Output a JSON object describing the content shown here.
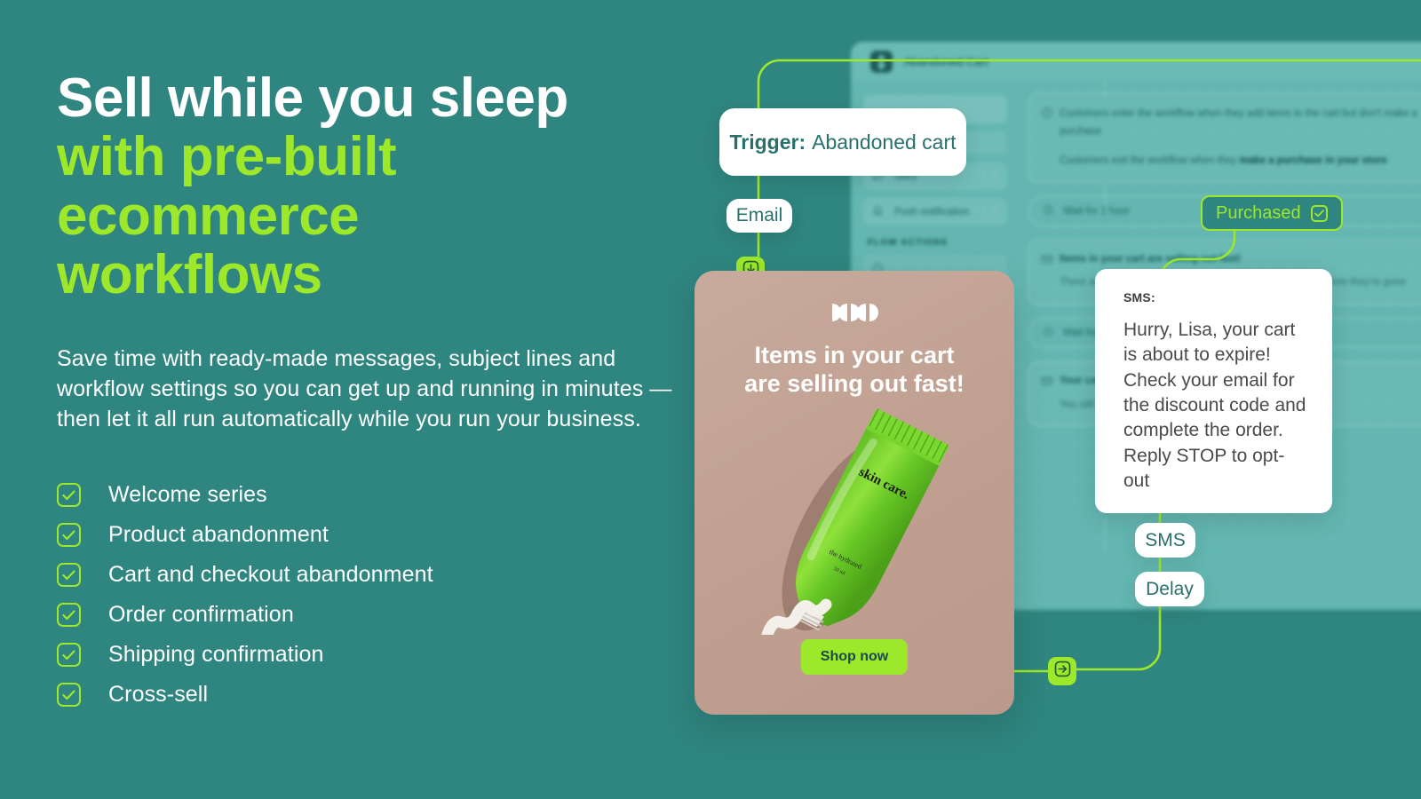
{
  "theme": {
    "bg_teal": "#2f857f",
    "accent_green": "#9ee82b",
    "panel_teal": "#63b6b1",
    "card_pink": "#c0a091",
    "white": "#ffffff"
  },
  "hero": {
    "headline_line1": "Sell while you sleep",
    "headline_line2": "with pre-built",
    "headline_line3": "ecommerce",
    "headline_line4": "workflows",
    "subcopy": "Save time with ready-made messages, subject lines and workflow settings so you can get up and running in minutes — then let it all run automatically while you run your business."
  },
  "features": [
    {
      "label": "Welcome series"
    },
    {
      "label": "Product abandonment"
    },
    {
      "label": "Cart and checkout abandonment"
    },
    {
      "label": "Order confirmation"
    },
    {
      "label": "Shipping confirmation"
    },
    {
      "label": "Cross-sell"
    }
  ],
  "app_panel": {
    "title": "Abandoned Cart",
    "sidebar": {
      "items": [
        {
          "label": "SMS",
          "icon": "chat-icon"
        },
        {
          "label": "Push notification",
          "icon": "bell-icon"
        }
      ],
      "section_header": "FLOW ACTIONS"
    },
    "cards": {
      "entry_rule": "Customers enter the workflow when they add items to the cart but don't make a purchase",
      "exit_rule_prefix": "Customers exit the workflow when they ",
      "exit_rule_bold": "make a purchase in your store",
      "wait_1": "Wait for 1 hour",
      "wait_2": "Wait for 11 h",
      "email_1_title": "Items in your cart are selling out fast!",
      "email_1_body": "There are items in your cart that can sell out soon. Order before they're gone",
      "email_2_title": "Your cart misses you!",
      "email_2_body": "You still got items left in your cart"
    }
  },
  "flow": {
    "trigger_label": "Trigger:",
    "trigger_value": "Abandoned cart",
    "email_chip": "Email",
    "sms_chip": "SMS",
    "delay_chip": "Delay",
    "purchased_badge": "Purchased",
    "node_down_icon": "arrow-down-icon",
    "node_right_icon": "arrow-right-icon"
  },
  "sms_bubble": {
    "label": "SMS:",
    "message": "Hurry, Lisa, your cart is about to expire! Check your email for the discount code and complete the order. Reply STOP to opt-out"
  },
  "email_preview": {
    "title_line1": "Items in your cart",
    "title_line2": "are selling out fast!",
    "cta": "Shop now",
    "product_label": "skin care.",
    "logo": "brand-logo"
  }
}
